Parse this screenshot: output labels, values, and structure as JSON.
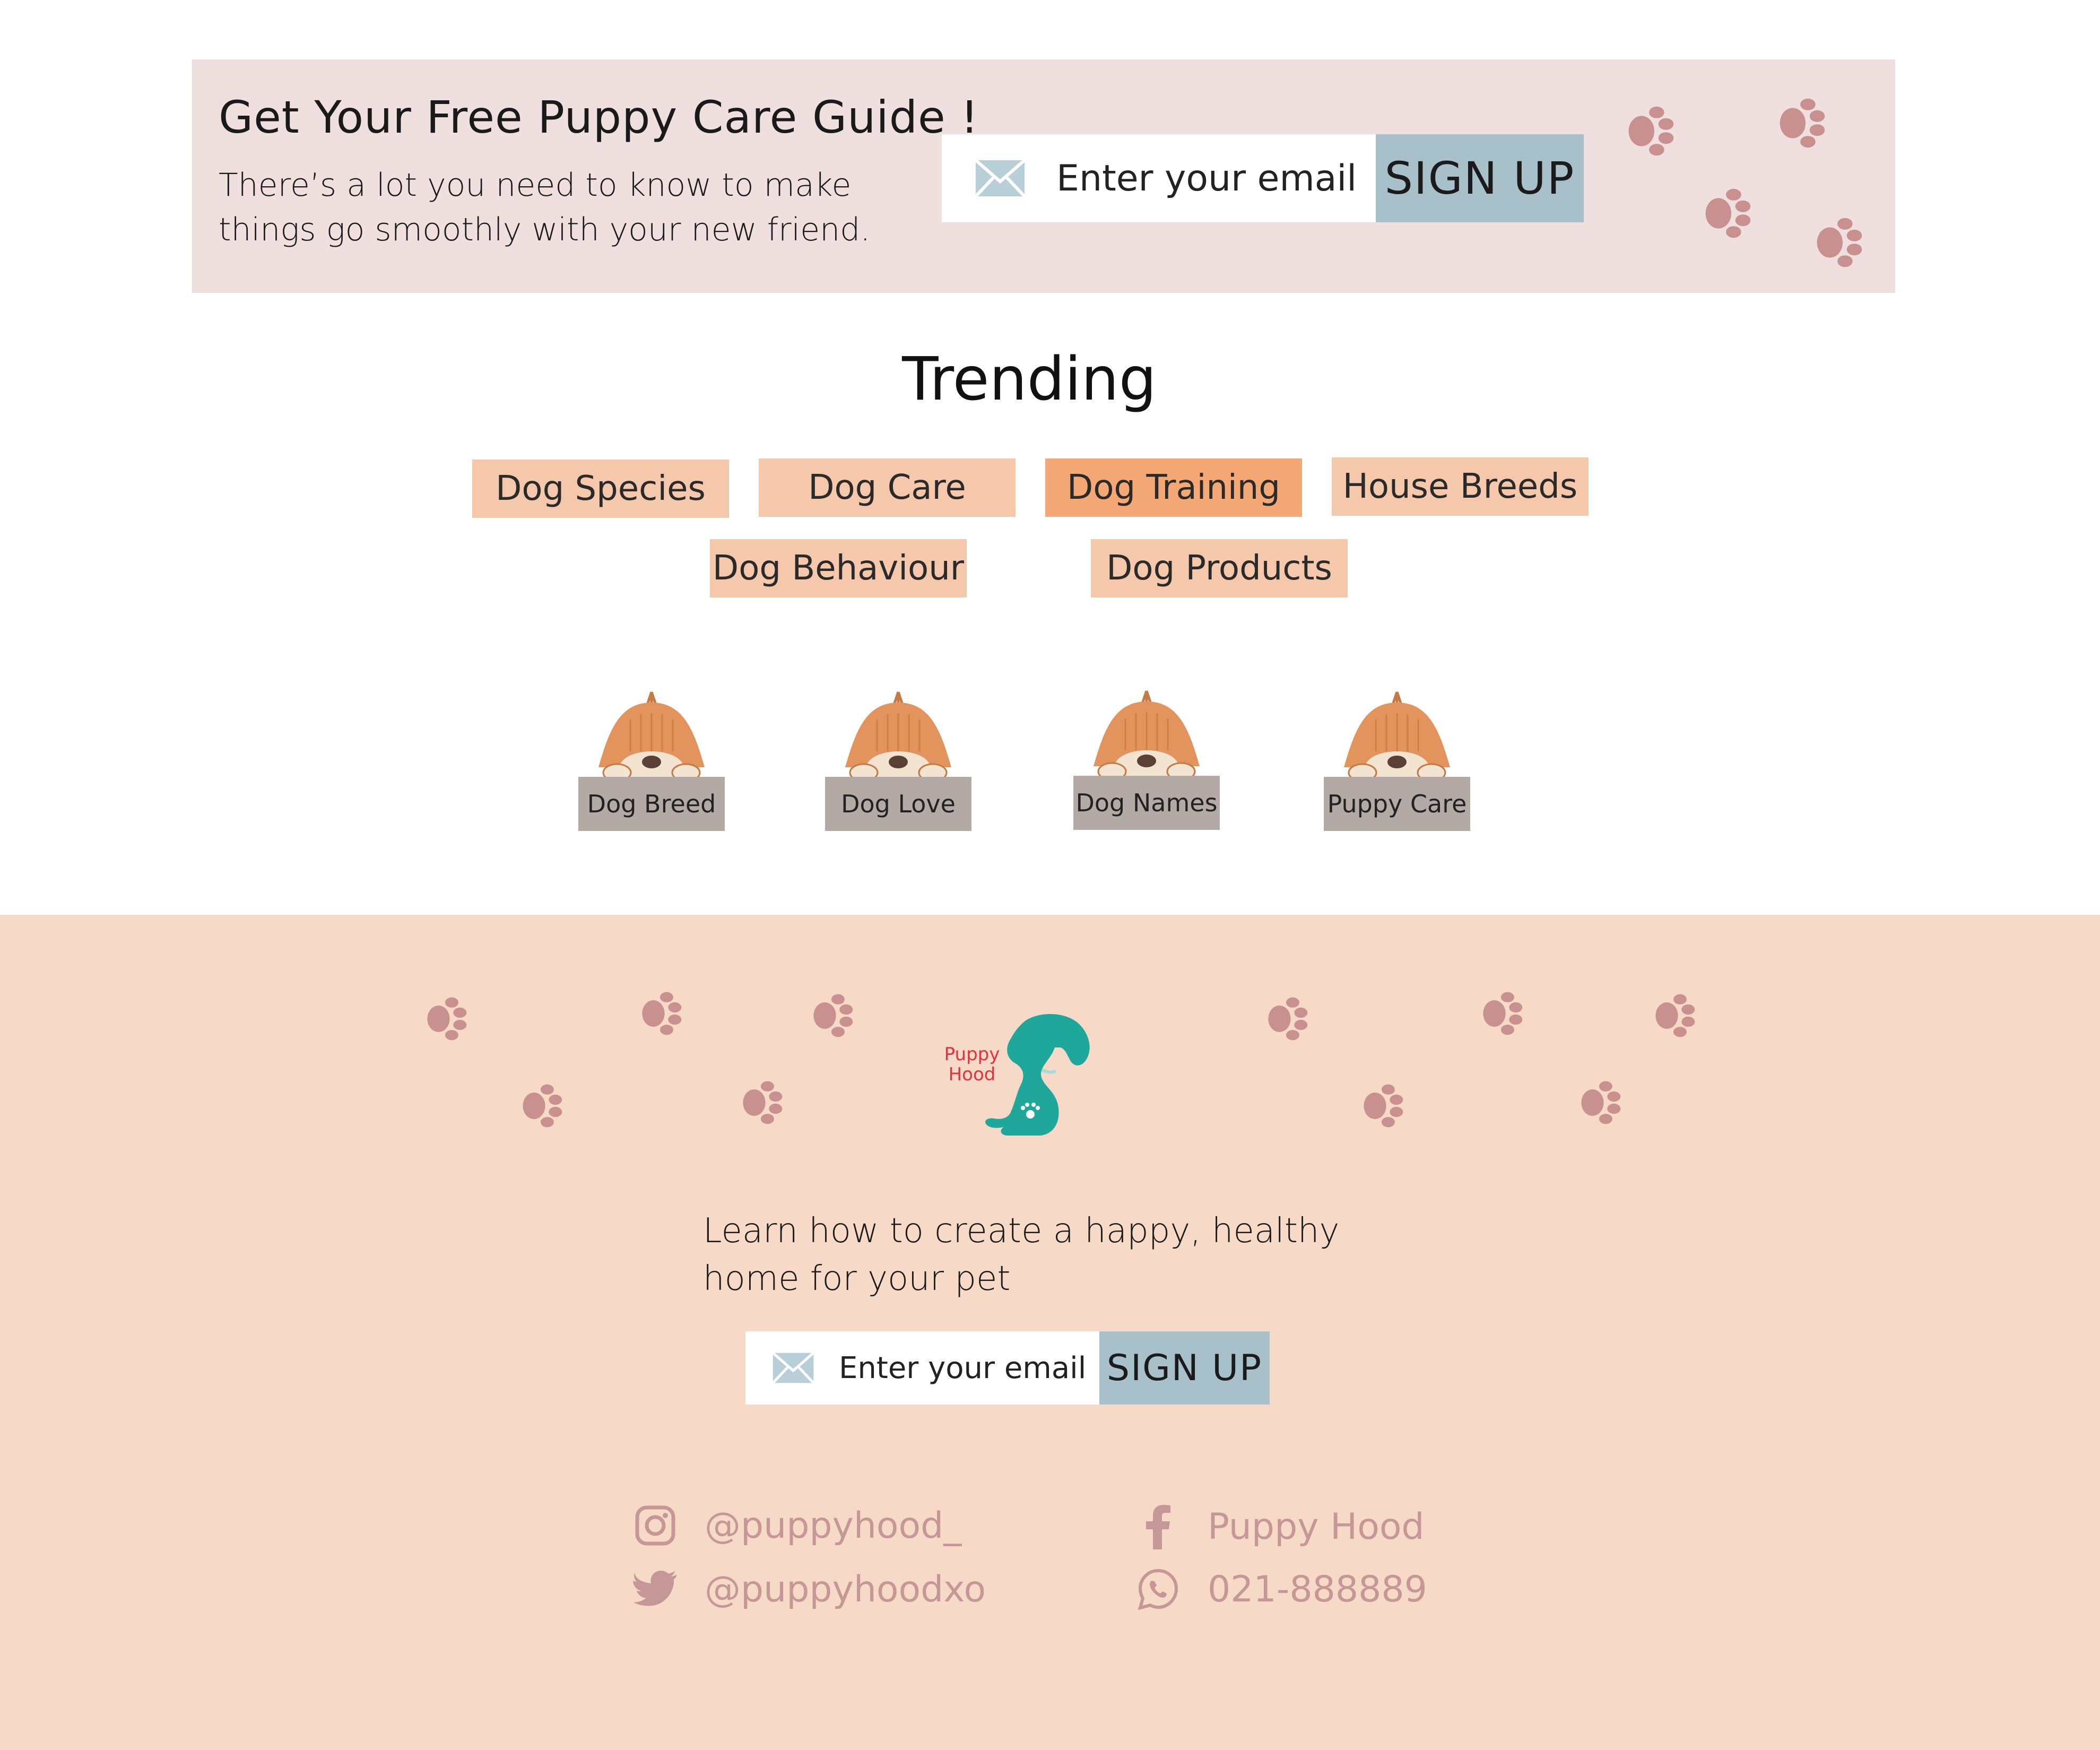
{
  "banner": {
    "title": "Get Your Free Puppy Care Guide !",
    "text": "There’s a lot you need to know to make things go smoothly with your new friend.",
    "email_placeholder": "Enter your email",
    "signup_label": "SIGN UP"
  },
  "trending": {
    "title": "Trending",
    "tags": [
      {
        "label": "Dog Species",
        "active": false
      },
      {
        "label": "Dog Care",
        "active": false
      },
      {
        "label": "Dog Training",
        "active": true
      },
      {
        "label": "House Breeds",
        "active": false
      },
      {
        "label": "Dog Behaviour",
        "active": false
      },
      {
        "label": "Dog Products",
        "active": false
      }
    ],
    "cards": [
      {
        "label": "Dog Breed"
      },
      {
        "label": "Dog Love"
      },
      {
        "label": "Dog Names"
      },
      {
        "label": "Puppy Care"
      }
    ]
  },
  "footer": {
    "logo_text_1": "Puppy",
    "logo_text_2": "Hood",
    "text": "Learn how to create a happy, healthy home for your pet",
    "email_placeholder": "Enter your email",
    "signup_label": "SIGN UP",
    "social": {
      "instagram": "@puppyhood_",
      "twitter": "@puppyhoodxo",
      "facebook": "Puppy Hood",
      "whatsapp": "021-888889"
    }
  },
  "colors": {
    "banner_bg": "#efdfdf",
    "tag": "#f5c8ab",
    "tag_active": "#f4a875",
    "signup_button": "#a8c0ca",
    "footer_bg": "#f6d9c6",
    "paw": "#c8918f",
    "logo_dog": "#1fa79b",
    "logo_text": "#e8303a",
    "social_text": "#c59797"
  }
}
